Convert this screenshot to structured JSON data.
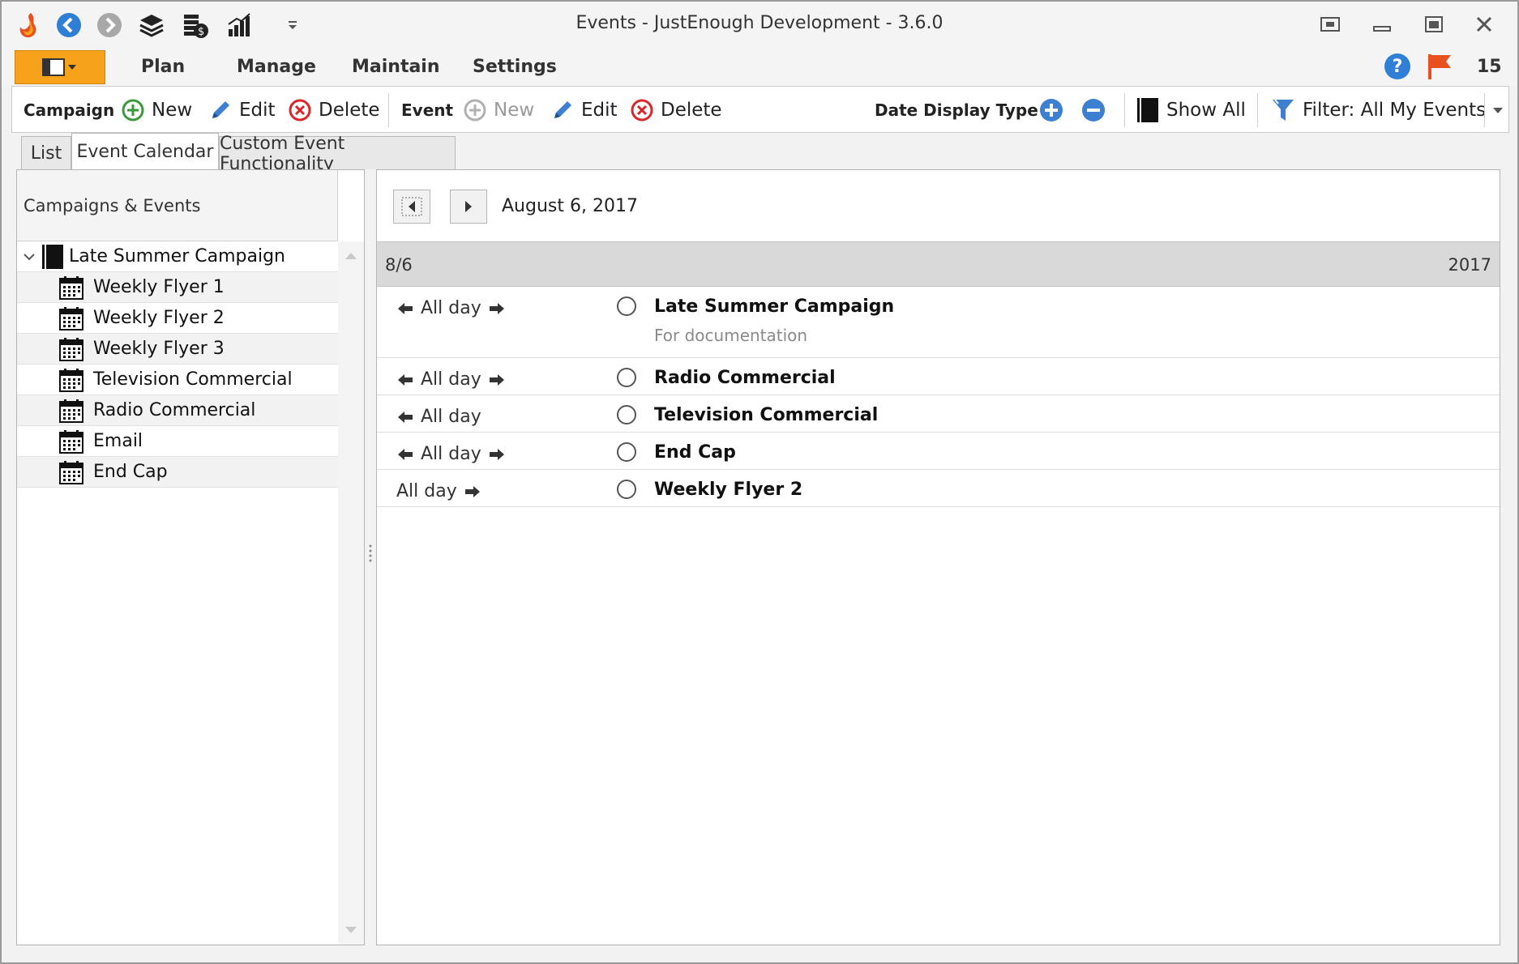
{
  "window": {
    "title": "Events - JustEnough Development - 3.6.0",
    "quick_access_icons": [
      "app-logo-icon",
      "back-icon",
      "forward-icon",
      "layers-icon",
      "coins-icon",
      "chart-icon",
      "customize-arrow-icon"
    ],
    "controls": [
      "restore-view-icon",
      "minimize-icon",
      "maximize-icon",
      "close-icon"
    ]
  },
  "menu": {
    "items": [
      "Plan",
      "Manage",
      "Maintain",
      "Settings"
    ],
    "notification_count": "15",
    "accent_color": "#f7a21b"
  },
  "toolbar": {
    "campaign_label": "Campaign",
    "campaign_new": "New",
    "campaign_edit": "Edit",
    "campaign_delete": "Delete",
    "event_label": "Event",
    "event_new": "New",
    "event_edit": "Edit",
    "event_delete": "Delete",
    "date_display_type": "Date Display Type",
    "show_all": "Show All",
    "filter": "Filter: All My Events"
  },
  "tabs": [
    "List",
    "Event Calendar",
    "Custom Event Functionality"
  ],
  "active_tab": "Event Calendar",
  "left_panel": {
    "header": "Campaigns & Events",
    "campaign": "Late Summer Campaign",
    "events": [
      "Weekly Flyer 1",
      "Weekly Flyer 2",
      "Weekly Flyer 3",
      "Television Commercial",
      "Radio Commercial",
      "Email",
      "End Cap"
    ]
  },
  "calendar": {
    "current_date": "August 6, 2017",
    "day_label": "8/6",
    "year_label": "2017",
    "events": [
      {
        "time": "All day",
        "title": "Late Summer Campaign",
        "subtitle": "For documentation"
      },
      {
        "time": "All day",
        "title": "Radio Commercial",
        "subtitle": ""
      },
      {
        "time": "All day",
        "title": "Television Commercial",
        "subtitle": ""
      },
      {
        "time": "All day",
        "title": "End Cap",
        "subtitle": ""
      },
      {
        "time": "All day",
        "title": "Weekly Flyer 2",
        "subtitle": ""
      }
    ]
  }
}
